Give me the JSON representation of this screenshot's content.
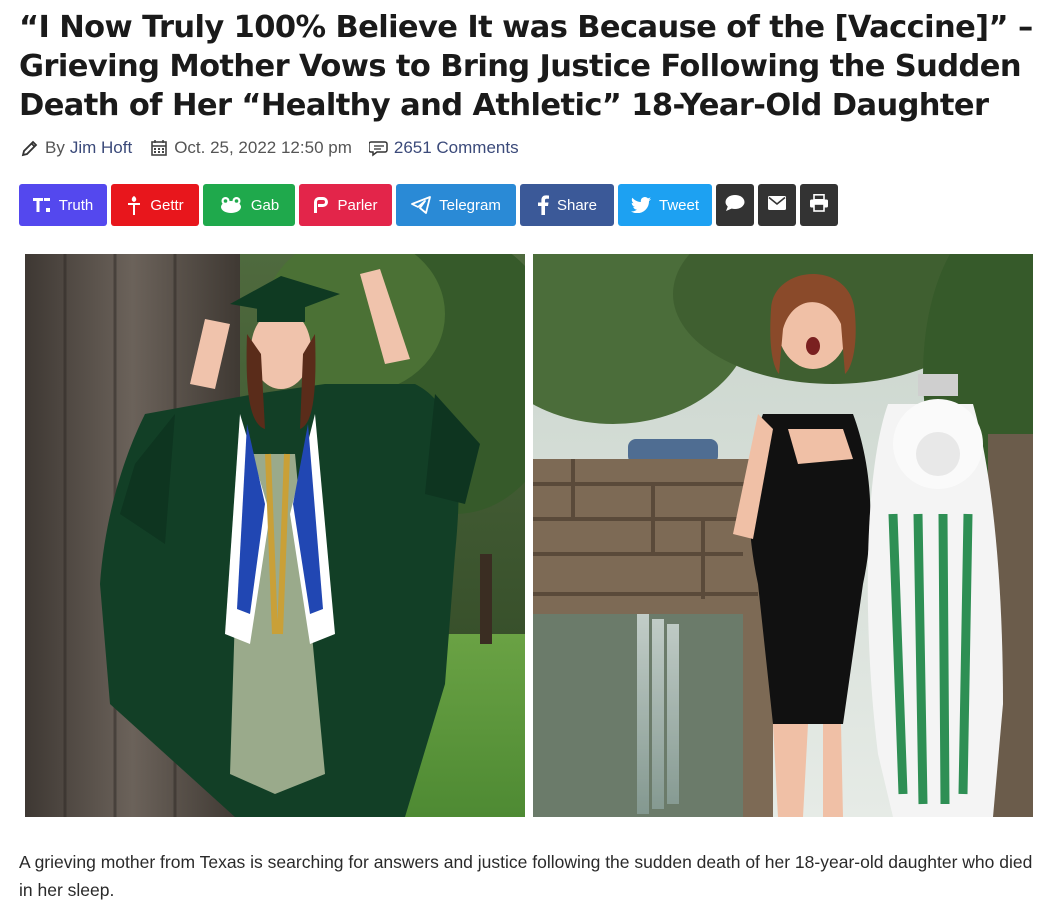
{
  "article": {
    "headline": "“I Now Truly 100% Believe It was Because of the [Vaccine]” – Grieving Mother Vows to Bring Justice Following the Sudden Death of Her “Healthy and Athletic” 18-Year-Old Daughter",
    "byline_prefix": "By",
    "author": "Jim Hoft",
    "date": "Oct. 25, 2022 12:50 pm",
    "comments": "2651 Comments",
    "caption": "A grieving mother from Texas is searching for answers and justice following the sudden death of her 18-year-old daughter who died in her sleep."
  },
  "share_buttons": [
    {
      "label": "Truth",
      "icon": "truth-social-icon",
      "color": "#5448ee"
    },
    {
      "label": "Gettr",
      "icon": "gettr-icon",
      "color": "#e8161c"
    },
    {
      "label": "Gab",
      "icon": "gab-frog-icon",
      "color": "#1fa94c"
    },
    {
      "label": "Parler",
      "icon": "parler-icon",
      "color": "#e3254a"
    },
    {
      "label": "Telegram",
      "icon": "telegram-icon",
      "color": "#2a8ad6"
    },
    {
      "label": "Share",
      "icon": "facebook-icon",
      "color": "#3b5998"
    },
    {
      "label": "Tweet",
      "icon": "twitter-icon",
      "color": "#1da1f2"
    },
    {
      "label": "",
      "icon": "sms-bubble-icon",
      "color": "#333333"
    },
    {
      "label": "",
      "icon": "email-icon",
      "color": "#333333"
    },
    {
      "label": "",
      "icon": "print-icon",
      "color": "#333333"
    }
  ],
  "images": {
    "left": "graduation-photo",
    "right": "homecoming-mum-photo"
  }
}
